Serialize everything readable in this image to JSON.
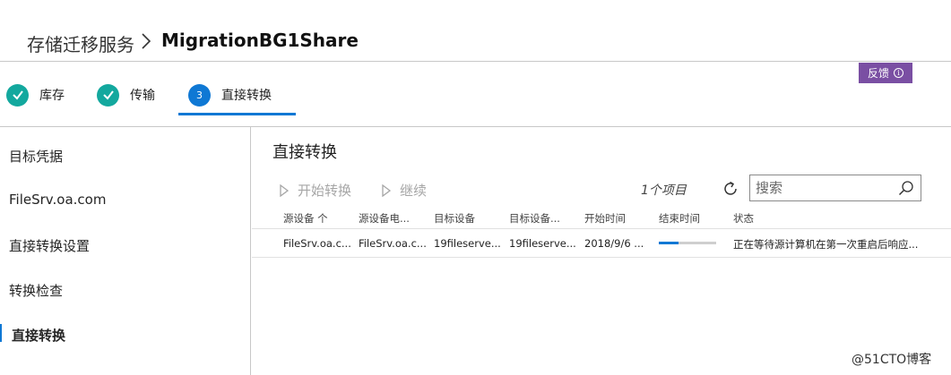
{
  "breadcrumb": {
    "parent": "存储迁移服务",
    "current": "MigrationBG1Share"
  },
  "feedback": {
    "label": "反馈",
    "icon": "info-icon"
  },
  "steps": [
    {
      "label": "库存",
      "state": "done",
      "icon": "check-icon"
    },
    {
      "label": "传输",
      "state": "done",
      "icon": "check-icon"
    },
    {
      "label": "直接转换",
      "state": "active",
      "number": "3"
    }
  ],
  "sidebar": {
    "items": [
      {
        "label": "目标凭据"
      },
      {
        "label": "FileSrv.oa.com"
      },
      {
        "label": "直接转换设置"
      },
      {
        "label": "转换检查"
      },
      {
        "label": "直接转换",
        "active": true
      }
    ]
  },
  "main": {
    "title": "直接转换",
    "toolbar": {
      "start_label": "开始转换",
      "continue_label": "继续",
      "item_count": "1个项目",
      "search_placeholder": "搜索"
    },
    "table": {
      "columns": [
        "源设备 个",
        "源设备电...",
        "目标设备",
        "目标设备...",
        "开始时间",
        "结束时间",
        "状态"
      ],
      "rows": [
        {
          "source_device": "FileSrv.oa.c...",
          "source_device_elec": "FileSrv.oa.c...",
          "target_device": "19fileserve...",
          "target_device_2": "19fileserve...",
          "start_time": "2018/9/6 ...",
          "end_time_progress": 0.35,
          "status": "正在等待源计算机在第一次重启后响应..."
        }
      ]
    }
  },
  "watermark": "@51CTO博客",
  "colors": {
    "accent": "#0f78d4",
    "done": "#13a89e",
    "feedback": "#7a4fa3"
  }
}
